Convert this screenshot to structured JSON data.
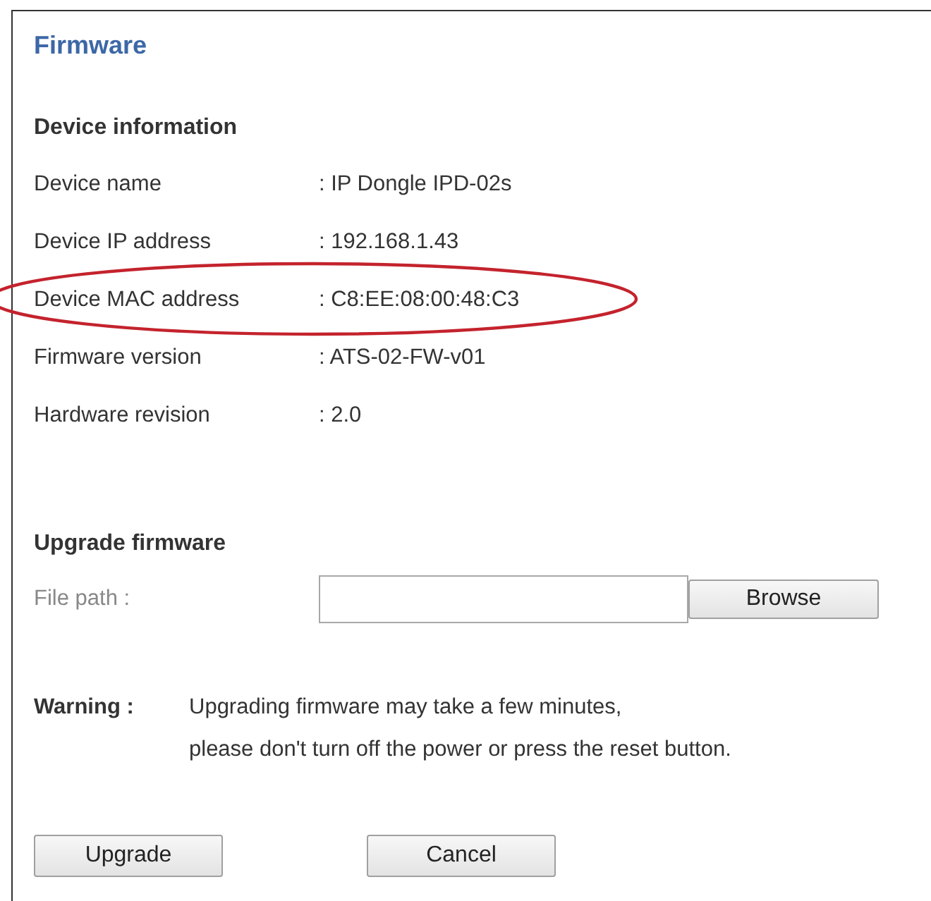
{
  "title": "Firmware",
  "info": {
    "heading": "Device information",
    "rows": [
      {
        "label": "Device name",
        "value": ": IP Dongle IPD-02s",
        "highlighted": false
      },
      {
        "label": "Device IP address",
        "value": ": 192.168.1.43",
        "highlighted": false
      },
      {
        "label": "Device MAC address",
        "value": ": C8:EE:08:00:48:C3",
        "highlighted": true
      },
      {
        "label": "Firmware version",
        "value": ": ATS-02-FW-v01",
        "highlighted": false
      },
      {
        "label": "Hardware revision",
        "value": ": 2.0",
        "highlighted": false
      }
    ]
  },
  "upgrade": {
    "heading": "Upgrade firmware",
    "file_label": "File path :",
    "browse_button": "Browse"
  },
  "warning": {
    "label": "Warning :",
    "lines": [
      "Upgrading firmware may take a few minutes,",
      "please don't turn off the power or press the reset button."
    ]
  },
  "buttons": [
    "Upgrade",
    "Cancel"
  ]
}
